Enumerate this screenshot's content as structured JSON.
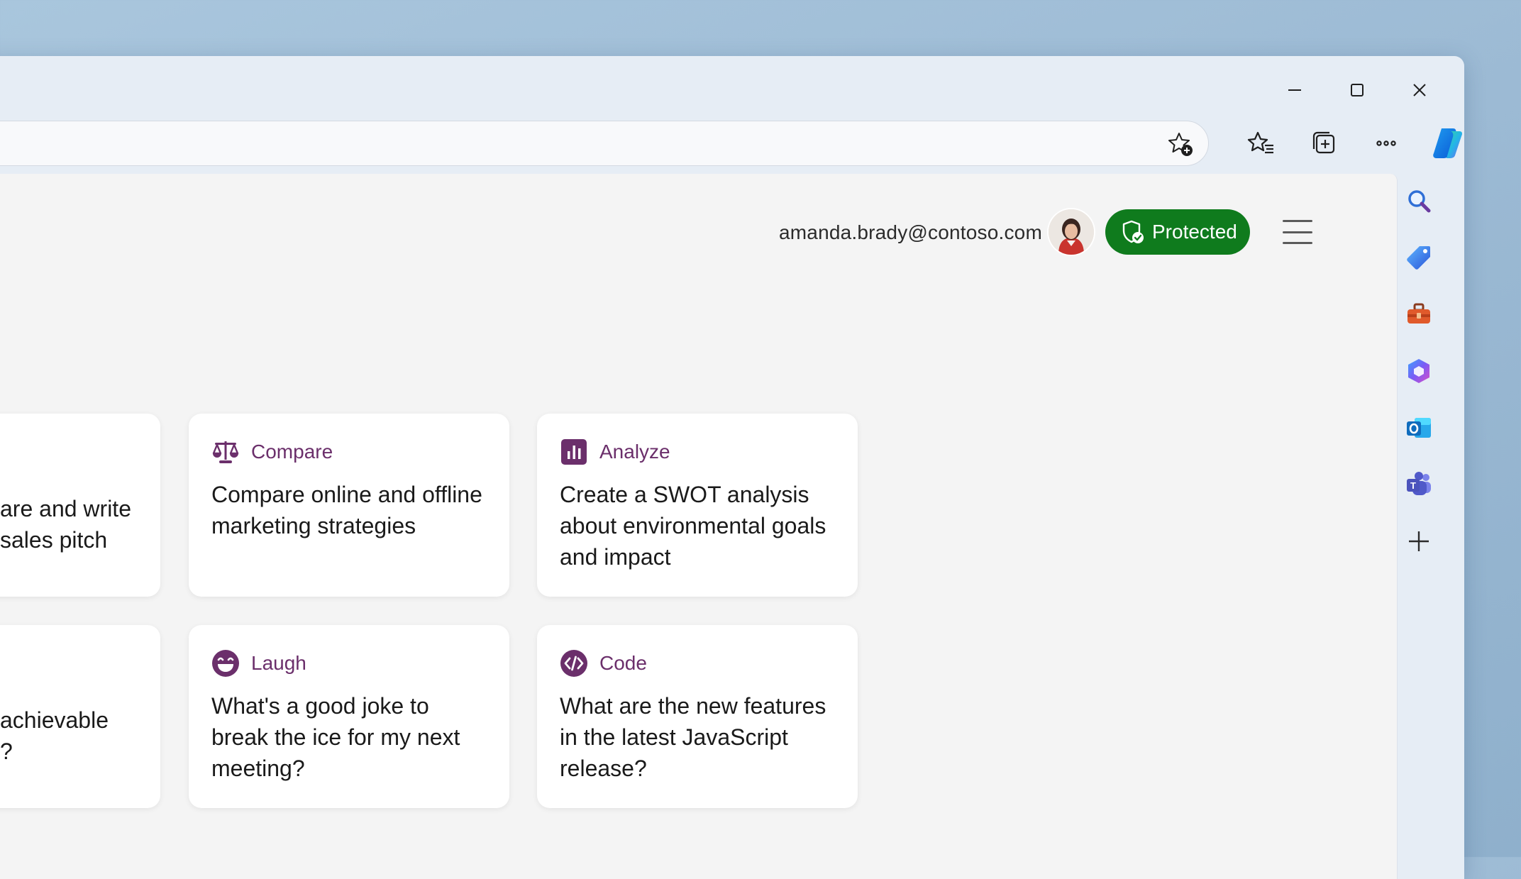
{
  "window": {
    "controls": {
      "minimize": "minimize",
      "maximize": "maximize",
      "close": "close"
    }
  },
  "toolbar": {
    "icons": [
      "favorite-add-icon",
      "favorites-icon",
      "collections-icon",
      "more-icon",
      "copilot-icon"
    ]
  },
  "sidebar": {
    "items": [
      "search",
      "shopping",
      "tools",
      "microsoft-365",
      "outlook",
      "teams",
      "add"
    ]
  },
  "header": {
    "email": "amanda.brady@contoso.com",
    "protected_label": "Protected",
    "accent": "#0f7b1d"
  },
  "cards": {
    "partial_top": {
      "text_line1": "are and write",
      "text_line2": "sales pitch"
    },
    "partial_bottom": {
      "text_line1": "achievable",
      "text_line2": "?"
    },
    "compare": {
      "category": "Compare",
      "text": "Compare online and offline marketing strategies"
    },
    "analyze": {
      "category": "Analyze",
      "text": "Create a SWOT analysis about environmental goals and impact"
    },
    "laugh": {
      "category": "Laugh",
      "text": "What's a good joke to break the ice for my next meeting?"
    },
    "code": {
      "category": "Code",
      "text": "What are the new features in the latest JavaScript release?"
    },
    "category_color": "#6b2f6b"
  }
}
